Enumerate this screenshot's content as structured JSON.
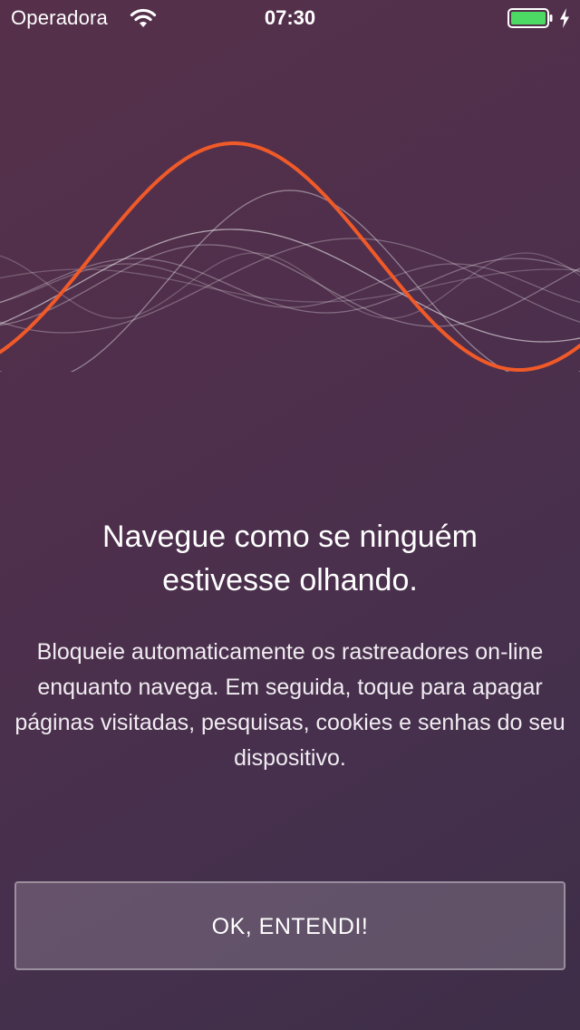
{
  "status_bar": {
    "carrier": "Operadora",
    "time": "07:30",
    "wifi_icon": "wifi-icon",
    "battery_icon": "battery-icon",
    "charging_icon": "charging-bolt-icon",
    "battery_level": 1.0
  },
  "illustration": {
    "icon": "sound-wave-illustration",
    "accent_color": "#f05a28"
  },
  "onboarding": {
    "headline": "Navegue como se ninguém estivesse olhando.",
    "description": "Bloqueie automaticamente os rastreadores on-line enquanto navega. Em seguida, toque para apagar páginas visitadas, pesquisas, cookies e senhas do seu dispositivo.",
    "button_label": "OK, ENTENDI!"
  },
  "colors": {
    "background_top": "#56304a",
    "background_bottom": "#3e2e48",
    "battery_fill": "#4cd964"
  }
}
